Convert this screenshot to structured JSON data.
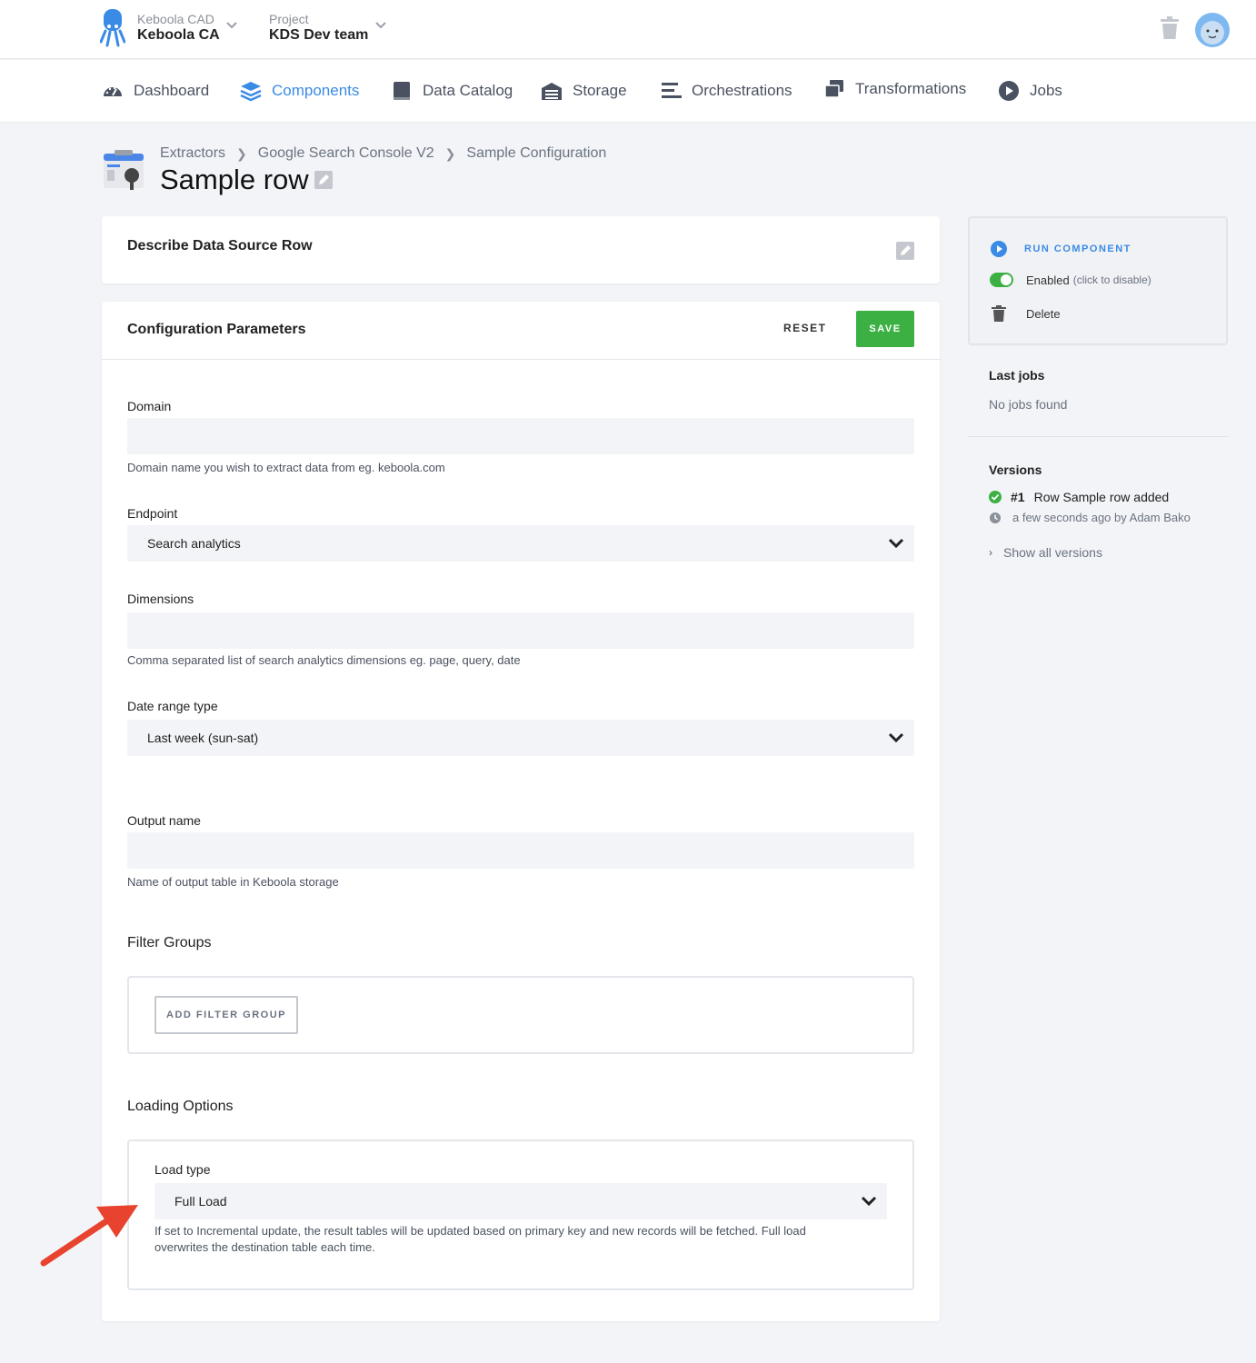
{
  "header": {
    "org_caption": "Keboola CAD",
    "org_name": "Keboola CA",
    "project_caption": "Project",
    "project_name": "KDS Dev team"
  },
  "nav": {
    "items": [
      {
        "label": "Dashboard",
        "icon": "dashboard-icon"
      },
      {
        "label": "Components",
        "icon": "layers-icon",
        "active": true
      },
      {
        "label": "Data Catalog",
        "icon": "book-icon"
      },
      {
        "label": "Storage",
        "icon": "warehouse-icon"
      },
      {
        "label": "Orchestrations",
        "icon": "bars-icon"
      },
      {
        "label": "Transformations",
        "icon": "windows-icon"
      },
      {
        "label": "Jobs",
        "icon": "play-circle-icon"
      }
    ]
  },
  "breadcrumb": [
    "Extractors",
    "Google Search Console V2",
    "Sample Configuration"
  ],
  "page_title": "Sample row",
  "describe": {
    "title": "Describe Data Source Row"
  },
  "config": {
    "title": "Configuration Parameters",
    "reset_label": "RESET",
    "save_label": "SAVE",
    "domain": {
      "label": "Domain",
      "value": "",
      "help": "Domain name you wish to extract data from eg. keboola.com"
    },
    "endpoint": {
      "label": "Endpoint",
      "value": "Search analytics"
    },
    "dimensions": {
      "label": "Dimensions",
      "value": "",
      "help": "Comma separated list of search analytics dimensions eg. page, query, date"
    },
    "date_range": {
      "label": "Date range type",
      "value": "Last week (sun-sat)"
    },
    "output_name": {
      "label": "Output name",
      "value": "",
      "help": "Name of output table in Keboola storage"
    },
    "filter_groups": {
      "title": "Filter Groups",
      "add_label": "ADD FILTER GROUP"
    },
    "loading": {
      "title": "Loading Options",
      "load_type_label": "Load type",
      "load_type_value": "Full Load",
      "help_line1": "If set to Incremental update, the result tables will be updated based on primary key and new records will be fetched. Full load",
      "help_line2": "overwrites the destination table each time."
    }
  },
  "sidebar": {
    "run_label": "RUN COMPONENT",
    "enabled_label": "Enabled",
    "enabled_hint": "(click to disable)",
    "delete_label": "Delete",
    "last_jobs_title": "Last jobs",
    "last_jobs_empty": "No jobs found",
    "versions_title": "Versions",
    "version_num": "#1",
    "version_desc": "Row Sample row added",
    "version_meta": "a few seconds ago by Adam Bako",
    "show_all": "Show all versions"
  },
  "colors": {
    "accent": "#3a8be6",
    "save": "#3cb043",
    "annotation_arrow": "#e8432e"
  }
}
